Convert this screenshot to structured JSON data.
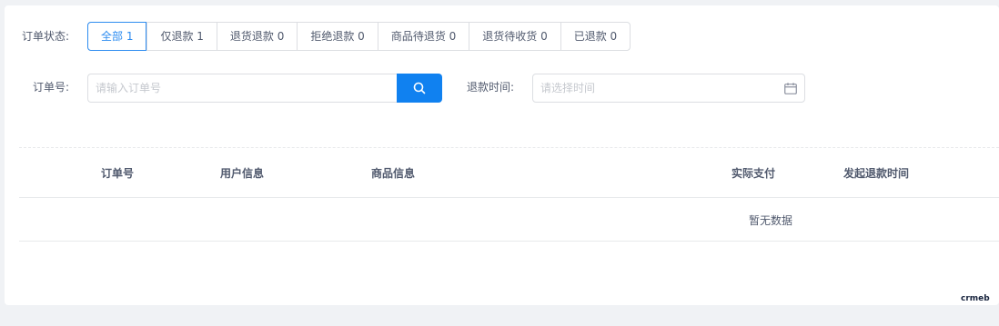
{
  "filters": {
    "status_label": "订单状态:",
    "tabs": [
      {
        "label": "全部 1",
        "active": true
      },
      {
        "label": "仅退款 1",
        "active": false
      },
      {
        "label": "退货退款 0",
        "active": false
      },
      {
        "label": "拒绝退款 0",
        "active": false
      },
      {
        "label": "商品待退货 0",
        "active": false
      },
      {
        "label": "退货待收货 0",
        "active": false
      },
      {
        "label": "已退款 0",
        "active": false
      }
    ],
    "order_label": "订单号:",
    "order_placeholder": "请输入订单号",
    "refund_time_label": "退款时间:",
    "refund_time_placeholder": "请选择时间"
  },
  "table": {
    "columns": [
      "订单号",
      "用户信息",
      "商品信息",
      "实际支付",
      "发起退款时间"
    ],
    "empty_text": "暂无数据"
  },
  "brand": "crmeb",
  "colors": {
    "accent": "#2d8cf0",
    "button": "#1081f0"
  },
  "icons": {
    "search": "search-icon",
    "calendar": "calendar-icon"
  }
}
